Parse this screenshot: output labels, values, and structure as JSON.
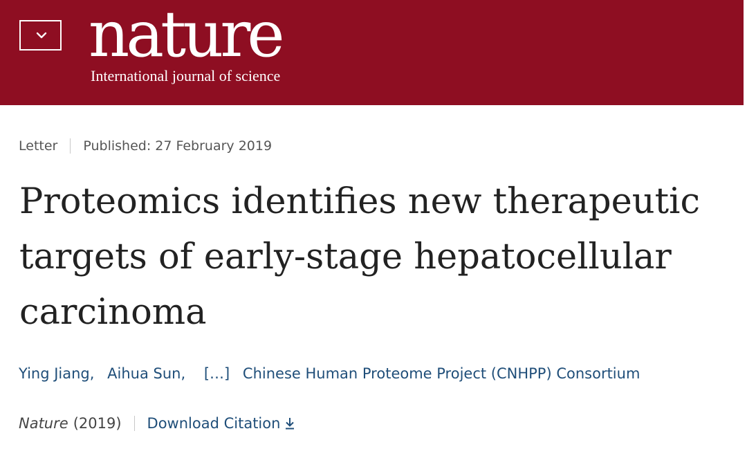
{
  "header": {
    "logo_text": "nature",
    "tagline": "International journal of science",
    "menu_icon": "chevron-down-icon"
  },
  "article": {
    "type": "Letter",
    "published": "Published: 27 February 2019",
    "title": "Proteomics identifies new therapeutic targets of early-stage hepatocellular carcinoma",
    "authors": {
      "author_1": "Ying Jiang,",
      "author_2": "Aihua Sun,",
      "ellipsis": "[…]",
      "consortium": "Chinese Human Proteome Project (CNHPP) Consortium"
    },
    "journal": "Nature",
    "year": "(2019)",
    "download_label": "Download Citation",
    "download_icon": "download-icon"
  },
  "colors": {
    "header_bg": "#8e0e22",
    "link": "#1f4e79"
  }
}
